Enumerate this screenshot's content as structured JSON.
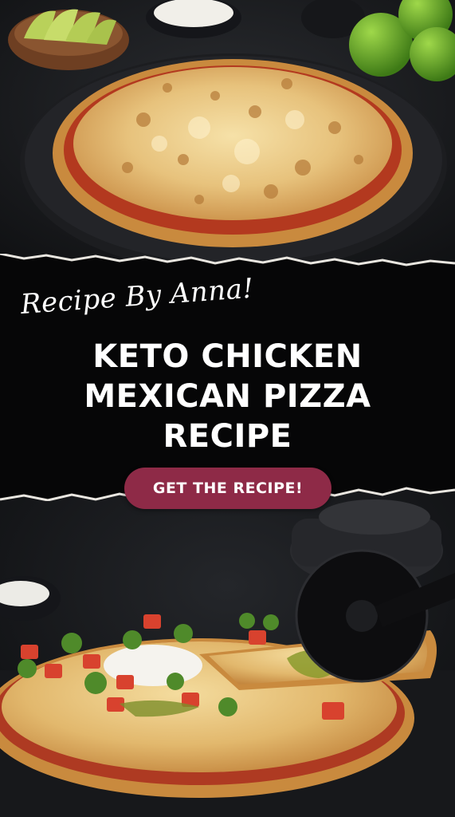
{
  "banner": {
    "byline": "Recipe By Anna!",
    "title_lines": [
      "KETO CHICKEN",
      "MEXICAN PIZZA",
      "RECIPE"
    ],
    "cta_label": "GET THE RECIPE!"
  },
  "colors": {
    "banner_bg": "#060607",
    "cta_bg": "#8e2a47",
    "text": "#ffffff",
    "cheese": "#e8c27a",
    "crust": "#c98a3e",
    "sauce": "#b33a24",
    "slate": "#1a1b1d"
  },
  "images": {
    "top": "top-pizza-photo",
    "bottom": "bottom-pizza-photo"
  }
}
